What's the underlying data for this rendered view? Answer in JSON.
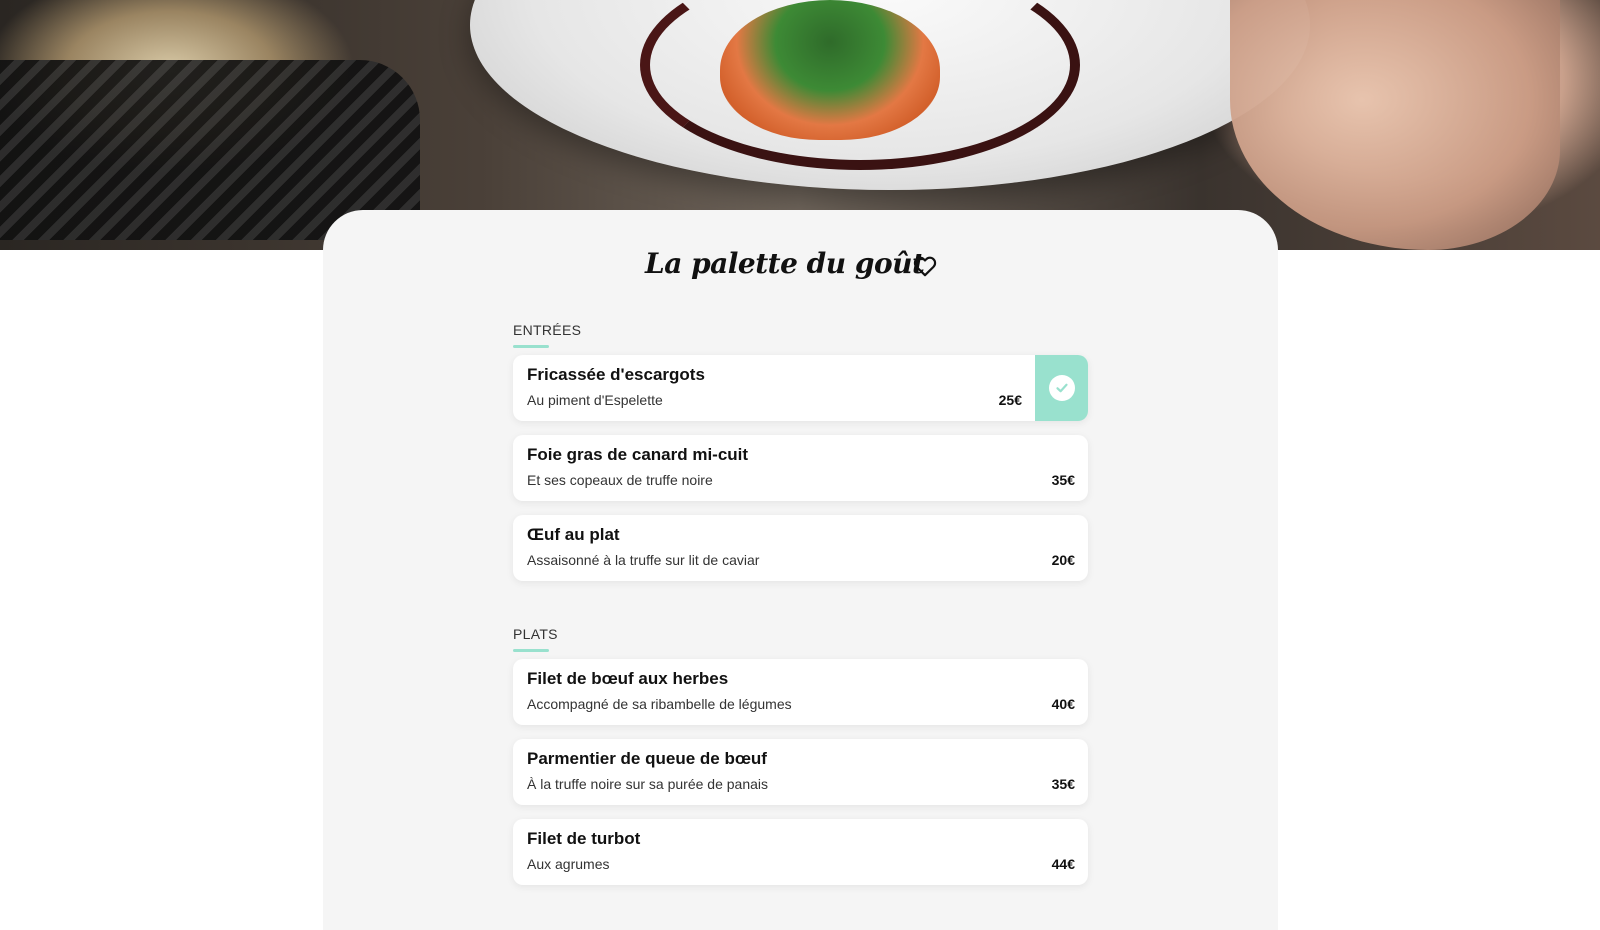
{
  "restaurant": {
    "name": "La palette du goût"
  },
  "sections": [
    {
      "title": "ENTRÉES",
      "items": [
        {
          "name": "Fricassée d'escargots",
          "description": "Au piment d'Espelette",
          "price": "25€",
          "selected": true
        },
        {
          "name": "Foie gras de canard mi-cuit",
          "description": "Et ses copeaux de truffe noire",
          "price": "35€",
          "selected": false
        },
        {
          "name": "Œuf au plat",
          "description": "Assaisonné à la truffe sur lit de caviar",
          "price": "20€",
          "selected": false
        }
      ]
    },
    {
      "title": "PLATS",
      "items": [
        {
          "name": "Filet de bœuf aux herbes",
          "description": "Accompagné de sa ribambelle de légumes",
          "price": "40€",
          "selected": false
        },
        {
          "name": "Parmentier de queue de bœuf",
          "description": "À la truffe noire sur sa purée de panais",
          "price": "35€",
          "selected": false
        },
        {
          "name": "Filet de turbot",
          "description": "Aux agrumes",
          "price": "44€",
          "selected": false
        }
      ]
    }
  ],
  "icons": {
    "favorite": "heart-icon",
    "selected": "check-icon"
  },
  "colors": {
    "accent": "#99e1ce",
    "card_background": "#f5f5f5",
    "item_background": "#ffffff"
  }
}
